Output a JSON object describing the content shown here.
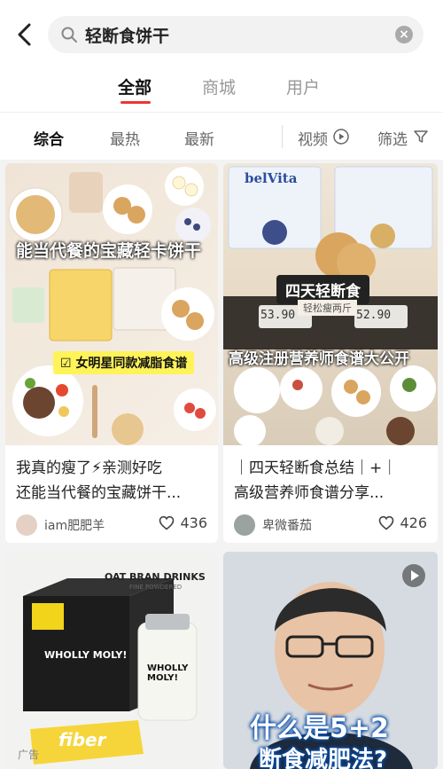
{
  "search": {
    "query": "轻断食饼干"
  },
  "top_tabs": [
    {
      "label": "全部",
      "active": true
    },
    {
      "label": "商城",
      "active": false
    },
    {
      "label": "用户",
      "active": false
    }
  ],
  "filters": {
    "sort": [
      {
        "label": "综合",
        "active": true
      },
      {
        "label": "最热",
        "active": false
      },
      {
        "label": "最新",
        "active": false
      }
    ],
    "video_label": "视频",
    "filter_label": "筛选"
  },
  "cards": [
    {
      "image_text": "能当代餐的宝藏轻卡饼干",
      "image_tag": "女明星同款减脂食谱",
      "title_line1": "我真的瘦了⚡亲测好吃",
      "title_line2": "还能当代餐的宝藏饼干...",
      "author": "iam肥肥羊",
      "likes": "436"
    },
    {
      "image_brand": "belVita",
      "image_text": "四天轻断食",
      "image_subtext": "轻松瘦两斤",
      "image_scale1": "53.90",
      "image_scale2": "52.90",
      "image_bottom": "高级注册营养师食谱大公开",
      "title_line1": "｜四天轻断食总结｜+｜",
      "title_line2": "高级营养师食谱分享...",
      "author": "卑微番茄",
      "likes": "426"
    },
    {
      "image_header": "OAT BRAN DRINKS",
      "image_subheader": "FINE POWDERED",
      "image_box_text": "WHOLLY MOLY!",
      "image_jar_text": "WHOLLY MOLY!",
      "image_card_text": "fiber",
      "ad_label": "广告"
    },
    {
      "image_text": "什么是5+2",
      "image_subtext": "断食减肥法?"
    }
  ],
  "colors": {
    "accent": "#e33b3b",
    "bg": "#f3f3f3"
  }
}
